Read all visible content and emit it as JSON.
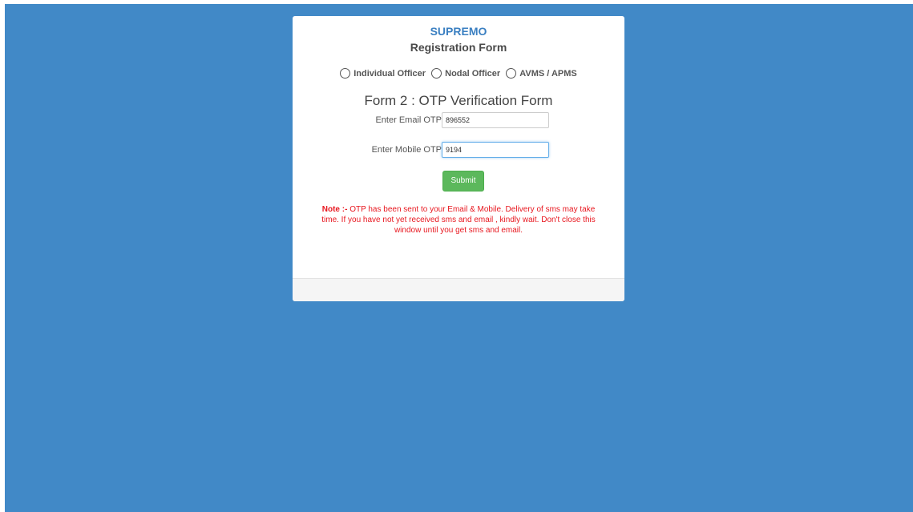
{
  "brand": "SUPREMO",
  "form_title": "Registration Form",
  "roles": [
    {
      "label": "Individual Officer",
      "selected": false
    },
    {
      "label": "Nodal Officer",
      "selected": false
    },
    {
      "label": "AVMS / APMS",
      "selected": false
    }
  ],
  "otp_form": {
    "title": "Form 2 : OTP Verification Form",
    "email_label": "Enter Email OTP",
    "email_value": "896552",
    "mobile_label": "Enter Mobile OTP",
    "mobile_value": "9194",
    "submit_label": "Submit"
  },
  "note": {
    "prefix": "Note :-",
    "text": " OTP has been sent to your Email & Mobile. Delivery of sms may take time. If you have not yet received sms and email , kindly wait. Don't close this window until you get sms and email."
  },
  "colors": {
    "background": "#4189c7",
    "brand": "#3a7fc1",
    "submit": "#5cb85c",
    "note": "#e8171f"
  }
}
